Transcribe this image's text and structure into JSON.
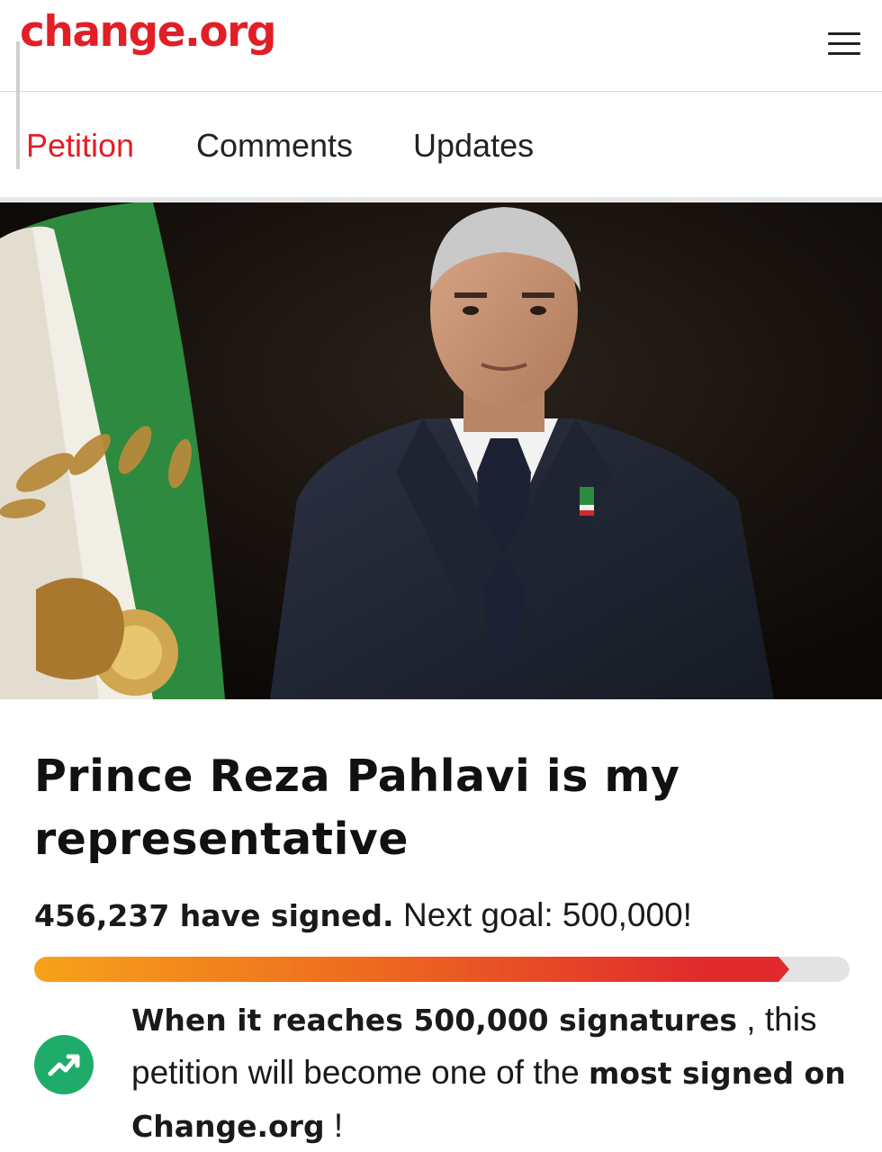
{
  "header": {
    "logo": "change.org",
    "menu_icon": "hamburger-menu-icon"
  },
  "tabs": [
    {
      "label": "Petition",
      "active": true
    },
    {
      "label": "Comments",
      "active": false
    },
    {
      "label": "Updates",
      "active": false
    }
  ],
  "hero": {
    "image": "portrait photo of man in dark suit beside Lion and Sun flag"
  },
  "petition": {
    "title": "Prince Reza Pahlavi is my representative",
    "signed_count": "456,237 have signed.",
    "next_goal": "Next goal: 500,000!",
    "progress_fraction": 0.9125,
    "milestone": {
      "icon": "trending-up-icon",
      "bold1": "When it reaches 500,000 signatures",
      "text1": " , this petition will become one of the ",
      "bold2": "most signed on Change.org",
      "text2": " !"
    }
  },
  "colors": {
    "brand": "#e21e26",
    "progress_start": "#f7a21a",
    "progress_end": "#e02a2d",
    "icon_green": "#1fac6b"
  }
}
